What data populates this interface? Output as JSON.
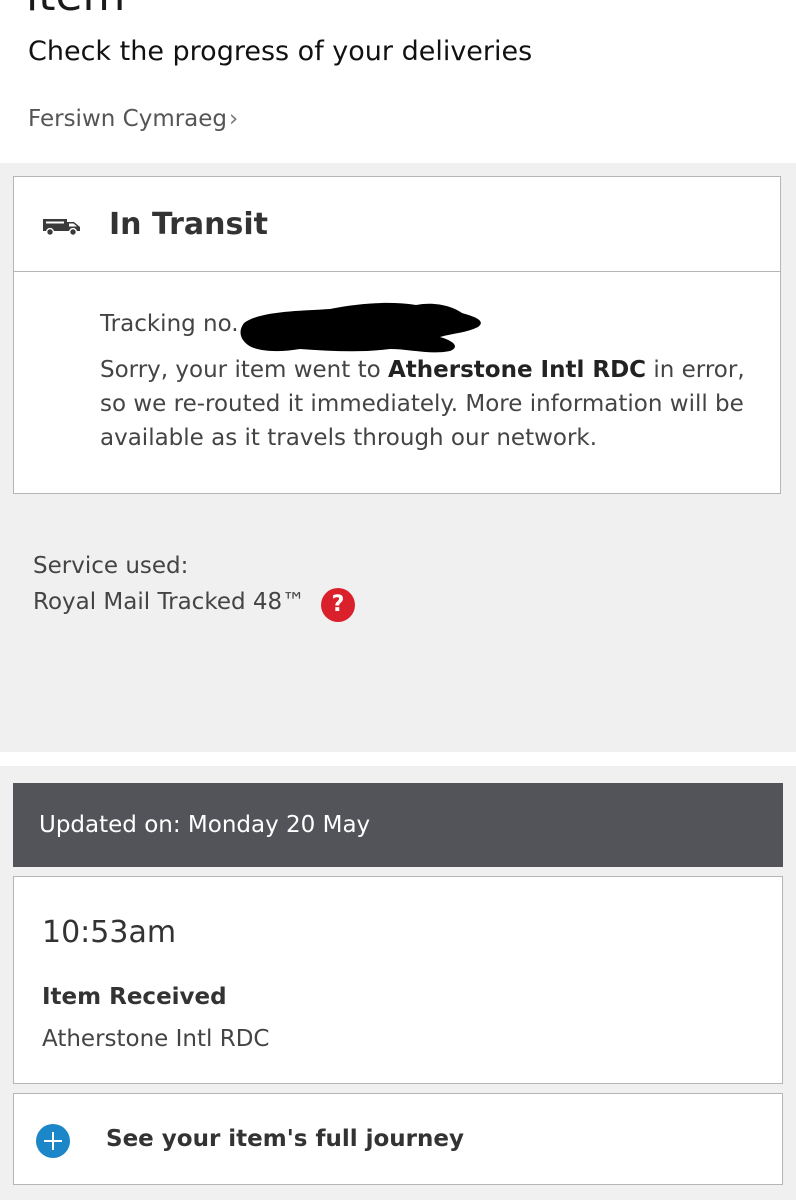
{
  "header": {
    "title": "item",
    "subtitle": "Check the progress of your deliveries",
    "welsh_link": "Fersiwn Cymraeg",
    "welsh_chevron": "›"
  },
  "status": {
    "icon": "van-icon",
    "title": "In Transit",
    "tracking_label": "Tracking no.",
    "tracking_number_redacted": true,
    "message_before": "Sorry, your item went to ",
    "message_location": "Atherstone Intl RDC",
    "message_after": " in error, so we re-routed it immediately. More information will be available as it travels through our network."
  },
  "service": {
    "label": "Service used:",
    "name": "Royal Mail Tracked 48™",
    "help_icon": "?"
  },
  "updates": {
    "updated_label": "Updated on: Monday 20 May",
    "events": [
      {
        "time": "10:53am",
        "title": "Item Received",
        "location": "Atherstone Intl RDC"
      }
    ],
    "journey_link": "See your item's full journey"
  },
  "colors": {
    "accent_red": "#da202a",
    "accent_blue": "#1b86c8",
    "bar_dark": "#535459",
    "panel_grey": "#f0f0f0",
    "border": "#b5b5b5"
  }
}
